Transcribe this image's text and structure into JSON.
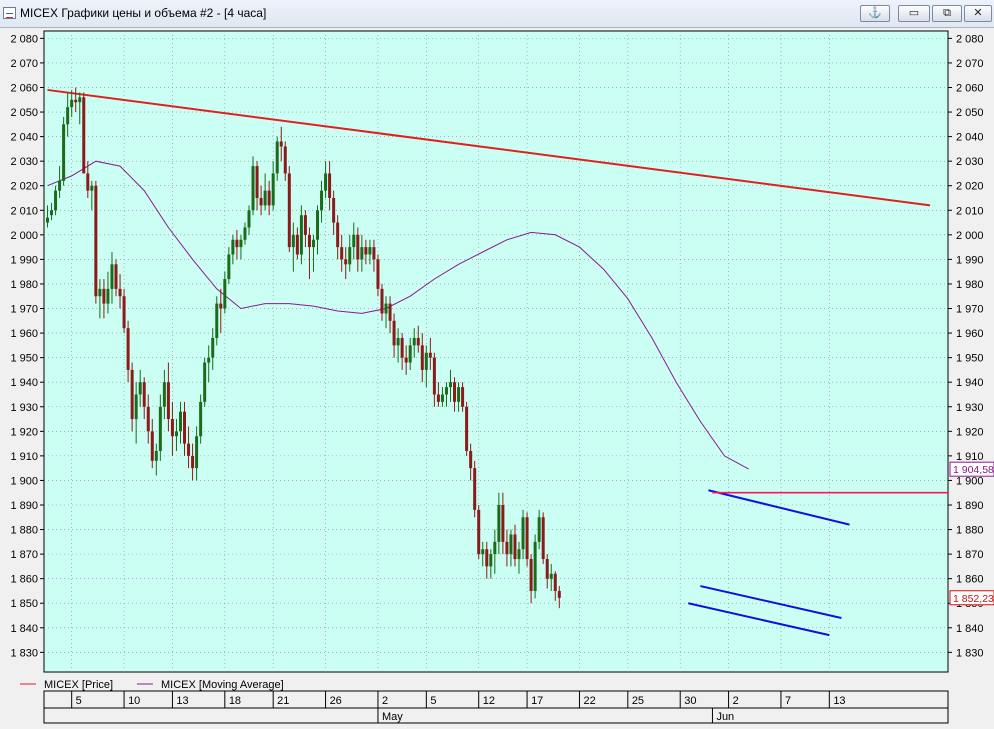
{
  "window": {
    "title": "MICEX Графики цены и объема #2 - [4 часа]",
    "anchor_glyph": "⚓",
    "minimize_glyph": "▭",
    "restore_glyph": "⧉",
    "close_glyph": "✕"
  },
  "colors": {
    "plot_background": "#ccfff3",
    "price_up": "#1a6b1a",
    "price_down": "#8b1a1a",
    "moving_average": "#8b1a8b",
    "resistance_line": "#e02020",
    "channel_lines": "#1010e0",
    "horizontal_level": "#ff1060"
  },
  "chart_data": {
    "type": "candlestick",
    "y_axis": {
      "min": 1822,
      "max": 2083,
      "ticks": [
        "2 080",
        "2 070",
        "2 060",
        "2 050",
        "2 040",
        "2 030",
        "2 020",
        "2 010",
        "2 000",
        "1 990",
        "1 980",
        "1 970",
        "1 960",
        "1 950",
        "1 940",
        "1 930",
        "1 920",
        "1 910",
        "1 900",
        "1 890",
        "1 880",
        "1 870",
        "1 860",
        "1 850",
        "1 840",
        "1 830"
      ],
      "tick_values": [
        2080,
        2070,
        2060,
        2050,
        2040,
        2030,
        2020,
        2010,
        2000,
        1990,
        1980,
        1970,
        1960,
        1950,
        1940,
        1930,
        1920,
        1910,
        1900,
        1890,
        1880,
        1870,
        1860,
        1850,
        1840,
        1830
      ]
    },
    "x_axis": {
      "day_labels": [
        "5",
        "10",
        "13",
        "18",
        "21",
        "26",
        "2",
        "5",
        "12",
        "17",
        "22",
        "25",
        "30",
        "2",
        "7",
        "13"
      ],
      "day_indices": [
        6,
        19,
        31,
        44,
        56,
        69,
        82,
        94,
        107,
        119,
        132,
        144,
        157,
        169,
        182,
        194
      ],
      "month_labels": [
        "May",
        "Jun"
      ],
      "month_indices": [
        82,
        165
      ]
    },
    "price_label": "1 852,23",
    "price_value": 1852.23,
    "ma_label": "1 904,58",
    "ma_value": 1904.58,
    "series": [
      {
        "name": "MICEX [Price]",
        "ohlc": [
          [
            2005.0,
            2012.0,
            2003.0,
            2007.0
          ],
          [
            2008.0,
            2013.0,
            2006.0,
            2010.0
          ],
          [
            2010.0,
            2020.0,
            2008.0,
            2018.0
          ],
          [
            2018.0,
            2028.0,
            2015.0,
            2022.0
          ],
          [
            2022.0,
            2048.0,
            2020.0,
            2045.0
          ],
          [
            2045.0,
            2058.0,
            2040.0,
            2052.0
          ],
          [
            2052.0,
            2059.0,
            2048.0,
            2055.0
          ],
          [
            2055.0,
            2060.0,
            2050.0,
            2054.0
          ],
          [
            2054.0,
            2058.0,
            2045.0,
            2056.0
          ],
          [
            2056.0,
            2058.0,
            2035.0,
            2025.0
          ],
          [
            2025.0,
            2030.0,
            2015.0,
            2018.0
          ],
          [
            2018.0,
            2022.0,
            2010.0,
            2020.0
          ],
          [
            2020.0,
            2022.0,
            1972.0,
            1975.0
          ],
          [
            1975.0,
            1982.0,
            1966.0,
            1978.0
          ],
          [
            1978.0,
            1982.0,
            1966.0,
            1972.0
          ],
          [
            1972.0,
            1985.0,
            1968.0,
            1978.0
          ],
          [
            1978.0,
            1993.0,
            1972.0,
            1988.0
          ],
          [
            1988.0,
            1990.0,
            1975.0,
            1978.0
          ],
          [
            1978.0,
            1984.0,
            1970.0,
            1975.0
          ],
          [
            1975.0,
            1978.0,
            1960.0,
            1962.0
          ],
          [
            1962.0,
            1965.0,
            1940.0,
            1945.0
          ],
          [
            1945.0,
            1948.0,
            1920.0,
            1925.0
          ],
          [
            1925.0,
            1940.0,
            1915.0,
            1935.0
          ],
          [
            1935.0,
            1945.0,
            1930.0,
            1940.0
          ],
          [
            1940.0,
            1942.0,
            1925.0,
            1930.0
          ],
          [
            1930.0,
            1935.0,
            1915.0,
            1920.0
          ],
          [
            1920.0,
            1925.0,
            1905.0,
            1908.0
          ],
          [
            1908.0,
            1915.0,
            1902.0,
            1912.0
          ],
          [
            1912.0,
            1935.0,
            1908.0,
            1930.0
          ],
          [
            1930.0,
            1945.0,
            1925.0,
            1940.0
          ],
          [
            1940.0,
            1948.0,
            1920.0,
            1925.0
          ],
          [
            1925.0,
            1932.0,
            1910.0,
            1918.0
          ],
          [
            1918.0,
            1925.0,
            1912.0,
            1920.0
          ],
          [
            1920.0,
            1932.0,
            1915.0,
            1928.0
          ],
          [
            1928.0,
            1932.0,
            1910.0,
            1915.0
          ],
          [
            1915.0,
            1922.0,
            1905.0,
            1910.0
          ],
          [
            1910.0,
            1915.0,
            1900.0,
            1905.0
          ],
          [
            1905.0,
            1922.0,
            1900.0,
            1918.0
          ],
          [
            1918.0,
            1935.0,
            1915.0,
            1932.0
          ],
          [
            1932.0,
            1950.0,
            1930.0,
            1948.0
          ],
          [
            1948.0,
            1955.0,
            1940.0,
            1950.0
          ],
          [
            1950.0,
            1962.0,
            1945.0,
            1958.0
          ],
          [
            1958.0,
            1975.0,
            1955.0,
            1972.0
          ],
          [
            1972.0,
            1978.0,
            1960.0,
            1970.0
          ],
          [
            1970.0,
            1985.0,
            1968.0,
            1982.0
          ],
          [
            1982.0,
            1995.0,
            1980.0,
            1992.0
          ],
          [
            1992.0,
            2000.0,
            1988.0,
            1998.0
          ],
          [
            1998.0,
            2002.0,
            1990.0,
            1995.0
          ],
          [
            1995.0,
            2000.0,
            1990.0,
            1998.0
          ],
          [
            1998.0,
            2005.0,
            1996.0,
            2003.0
          ],
          [
            2003.0,
            2012.0,
            2000.0,
            2010.0
          ],
          [
            2010.0,
            2032.0,
            2008.0,
            2028.0
          ],
          [
            2028.0,
            2030.0,
            2010.0,
            2015.0
          ],
          [
            2015.0,
            2020.0,
            2008.0,
            2012.0
          ],
          [
            2012.0,
            2025.0,
            2010.0,
            2018.0
          ],
          [
            2018.0,
            2022.0,
            2008.0,
            2012.0
          ],
          [
            2012.0,
            2030.0,
            2010.0,
            2025.0
          ],
          [
            2025.0,
            2040.0,
            2022.0,
            2038.0
          ],
          [
            2038.0,
            2044.0,
            2030.0,
            2036.0
          ],
          [
            2036.0,
            2038.0,
            2022.0,
            2025.0
          ],
          [
            2025.0,
            2028.0,
            1993.0,
            1995.0
          ],
          [
            1995.0,
            2005.0,
            1985.0,
            2000.0
          ],
          [
            2000.0,
            2003.0,
            1990.0,
            1992.0
          ],
          [
            1992.0,
            2012.0,
            1988.0,
            2008.0
          ],
          [
            2008.0,
            2010.0,
            1995.0,
            2000.0
          ],
          [
            2000.0,
            2003.0,
            1982.0,
            1995.0
          ],
          [
            1995.0,
            2000.0,
            1985.0,
            1998.0
          ],
          [
            1998.0,
            2012.0,
            1992.0,
            2010.0
          ],
          [
            2010.0,
            2022.0,
            2005.0,
            2018.0
          ],
          [
            2018.0,
            2030.0,
            2015.0,
            2025.0
          ],
          [
            2025.0,
            2030.0,
            2010.0,
            2015.0
          ],
          [
            2015.0,
            2018.0,
            2000.0,
            2005.0
          ],
          [
            2005.0,
            2008.0,
            1990.0,
            1995.0
          ],
          [
            1995.0,
            2000.0,
            1985.0,
            1990.0
          ],
          [
            1990.0,
            1995.0,
            1982.0,
            1988.0
          ],
          [
            1988.0,
            2000.0,
            1985.0,
            1995.0
          ],
          [
            1995.0,
            2005.0,
            1990.0,
            2000.0
          ],
          [
            2000.0,
            2003.0,
            1985.0,
            1990.0
          ],
          [
            1990.0,
            2000.0,
            1985.0,
            1995.0
          ],
          [
            1995.0,
            1998.0,
            1988.0,
            1992.0
          ],
          [
            1992.0,
            1998.0,
            1988.0,
            1995.0
          ],
          [
            1995.0,
            1998.0,
            1985.0,
            1990.0
          ],
          [
            1990.0,
            1992.0,
            1975.0,
            1978.0
          ],
          [
            1978.0,
            1980.0,
            1965.0,
            1968.0
          ],
          [
            1968.0,
            1975.0,
            1962.0,
            1972.0
          ],
          [
            1972.0,
            1975.0,
            1960.0,
            1965.0
          ],
          [
            1965.0,
            1968.0,
            1950.0,
            1955.0
          ],
          [
            1955.0,
            1962.0,
            1948.0,
            1958.0
          ],
          [
            1958.0,
            1960.0,
            1945.0,
            1950.0
          ],
          [
            1950.0,
            1955.0,
            1943.0,
            1948.0
          ],
          [
            1948.0,
            1958.0,
            1945.0,
            1955.0
          ],
          [
            1955.0,
            1962.0,
            1950.0,
            1958.0
          ],
          [
            1958.0,
            1963.0,
            1952.0,
            1955.0
          ],
          [
            1955.0,
            1960.0,
            1940.0,
            1945.0
          ],
          [
            1945.0,
            1955.0,
            1938.0,
            1952.0
          ],
          [
            1952.0,
            1958.0,
            1945.0,
            1950.0
          ],
          [
            1950.0,
            1952.0,
            1930.0,
            1935.0
          ],
          [
            1935.0,
            1940.0,
            1930.0,
            1932.0
          ],
          [
            1932.0,
            1938.0,
            1930.0,
            1935.0
          ],
          [
            1935.0,
            1940.0,
            1930.0,
            1938.0
          ],
          [
            1938.0,
            1945.0,
            1932.0,
            1940.0
          ],
          [
            1940.0,
            1942.0,
            1928.0,
            1932.0
          ],
          [
            1932.0,
            1940.0,
            1928.0,
            1938.0
          ],
          [
            1938.0,
            1940.0,
            1928.0,
            1930.0
          ],
          [
            1930.0,
            1932.0,
            1910.0,
            1912.0
          ],
          [
            1912.0,
            1915.0,
            1900.0,
            1905.0
          ],
          [
            1905.0,
            1908.0,
            1885.0,
            1888.0
          ],
          [
            1888.0,
            1890.0,
            1868.0,
            1870.0
          ],
          [
            1870.0,
            1875.0,
            1865.0,
            1872.0
          ],
          [
            1872.0,
            1875.0,
            1860.0,
            1865.0
          ],
          [
            1865.0,
            1872.0,
            1860.0,
            1870.0
          ],
          [
            1870.0,
            1880.0,
            1862.0,
            1875.0
          ],
          [
            1875.0,
            1895.0,
            1870.0,
            1890.0
          ],
          [
            1890.0,
            1895.0,
            1870.0,
            1875.0
          ],
          [
            1875.0,
            1880.0,
            1865.0,
            1870.0
          ],
          [
            1870.0,
            1880.0,
            1865.0,
            1878.0
          ],
          [
            1878.0,
            1882.0,
            1865.0,
            1868.0
          ],
          [
            1868.0,
            1875.0,
            1862.0,
            1872.0
          ],
          [
            1872.0,
            1888.0,
            1868.0,
            1885.0
          ],
          [
            1885.0,
            1887.0,
            1865.0,
            1868.0
          ],
          [
            1868.0,
            1870.0,
            1850.0,
            1855.0
          ],
          [
            1855.0,
            1878.0,
            1852.0,
            1875.0
          ],
          [
            1875.0,
            1888.0,
            1872.0,
            1885.0
          ],
          [
            1885.0,
            1887.0,
            1866.0,
            1868.0
          ],
          [
            1868.0,
            1870.0,
            1856.0,
            1860.0
          ],
          [
            1860.0,
            1866.0,
            1855.0,
            1862.0
          ],
          [
            1862.0,
            1863.0,
            1851.0,
            1855.0
          ],
          [
            1855.0,
            1857.0,
            1848.0,
            1852.2
          ]
        ]
      },
      {
        "name": "MICEX [Moving Average]",
        "points": [
          [
            0,
            2020
          ],
          [
            6,
            2024
          ],
          [
            12,
            2030
          ],
          [
            18,
            2028
          ],
          [
            24,
            2018
          ],
          [
            30,
            2003
          ],
          [
            36,
            1990
          ],
          [
            42,
            1978
          ],
          [
            48,
            1970
          ],
          [
            54,
            1972
          ],
          [
            60,
            1972
          ],
          [
            66,
            1971
          ],
          [
            72,
            1969
          ],
          [
            78,
            1968
          ],
          [
            84,
            1970
          ],
          [
            90,
            1975
          ],
          [
            96,
            1982
          ],
          [
            102,
            1988
          ],
          [
            108,
            1993
          ],
          [
            114,
            1998
          ],
          [
            120,
            2001
          ],
          [
            126,
            2000
          ],
          [
            132,
            1995
          ],
          [
            138,
            1986
          ],
          [
            144,
            1974
          ],
          [
            150,
            1958
          ],
          [
            156,
            1940
          ],
          [
            162,
            1924
          ],
          [
            168,
            1910
          ],
          [
            174,
            1904.6
          ]
        ]
      }
    ],
    "trendlines": [
      {
        "role": "resistance",
        "start": [
          0,
          2059
        ],
        "end": [
          219,
          2012
        ]
      },
      {
        "role": "channel-upper",
        "start": [
          164,
          1896
        ],
        "end": [
          199,
          1882
        ]
      },
      {
        "role": "channel-middle",
        "start": [
          162,
          1857
        ],
        "end": [
          197,
          1844
        ]
      },
      {
        "role": "channel-lower",
        "start": [
          159,
          1850
        ],
        "end": [
          194,
          1837
        ]
      }
    ],
    "horizontal_levels": [
      {
        "value": 1895,
        "from_index": 165
      }
    ]
  }
}
